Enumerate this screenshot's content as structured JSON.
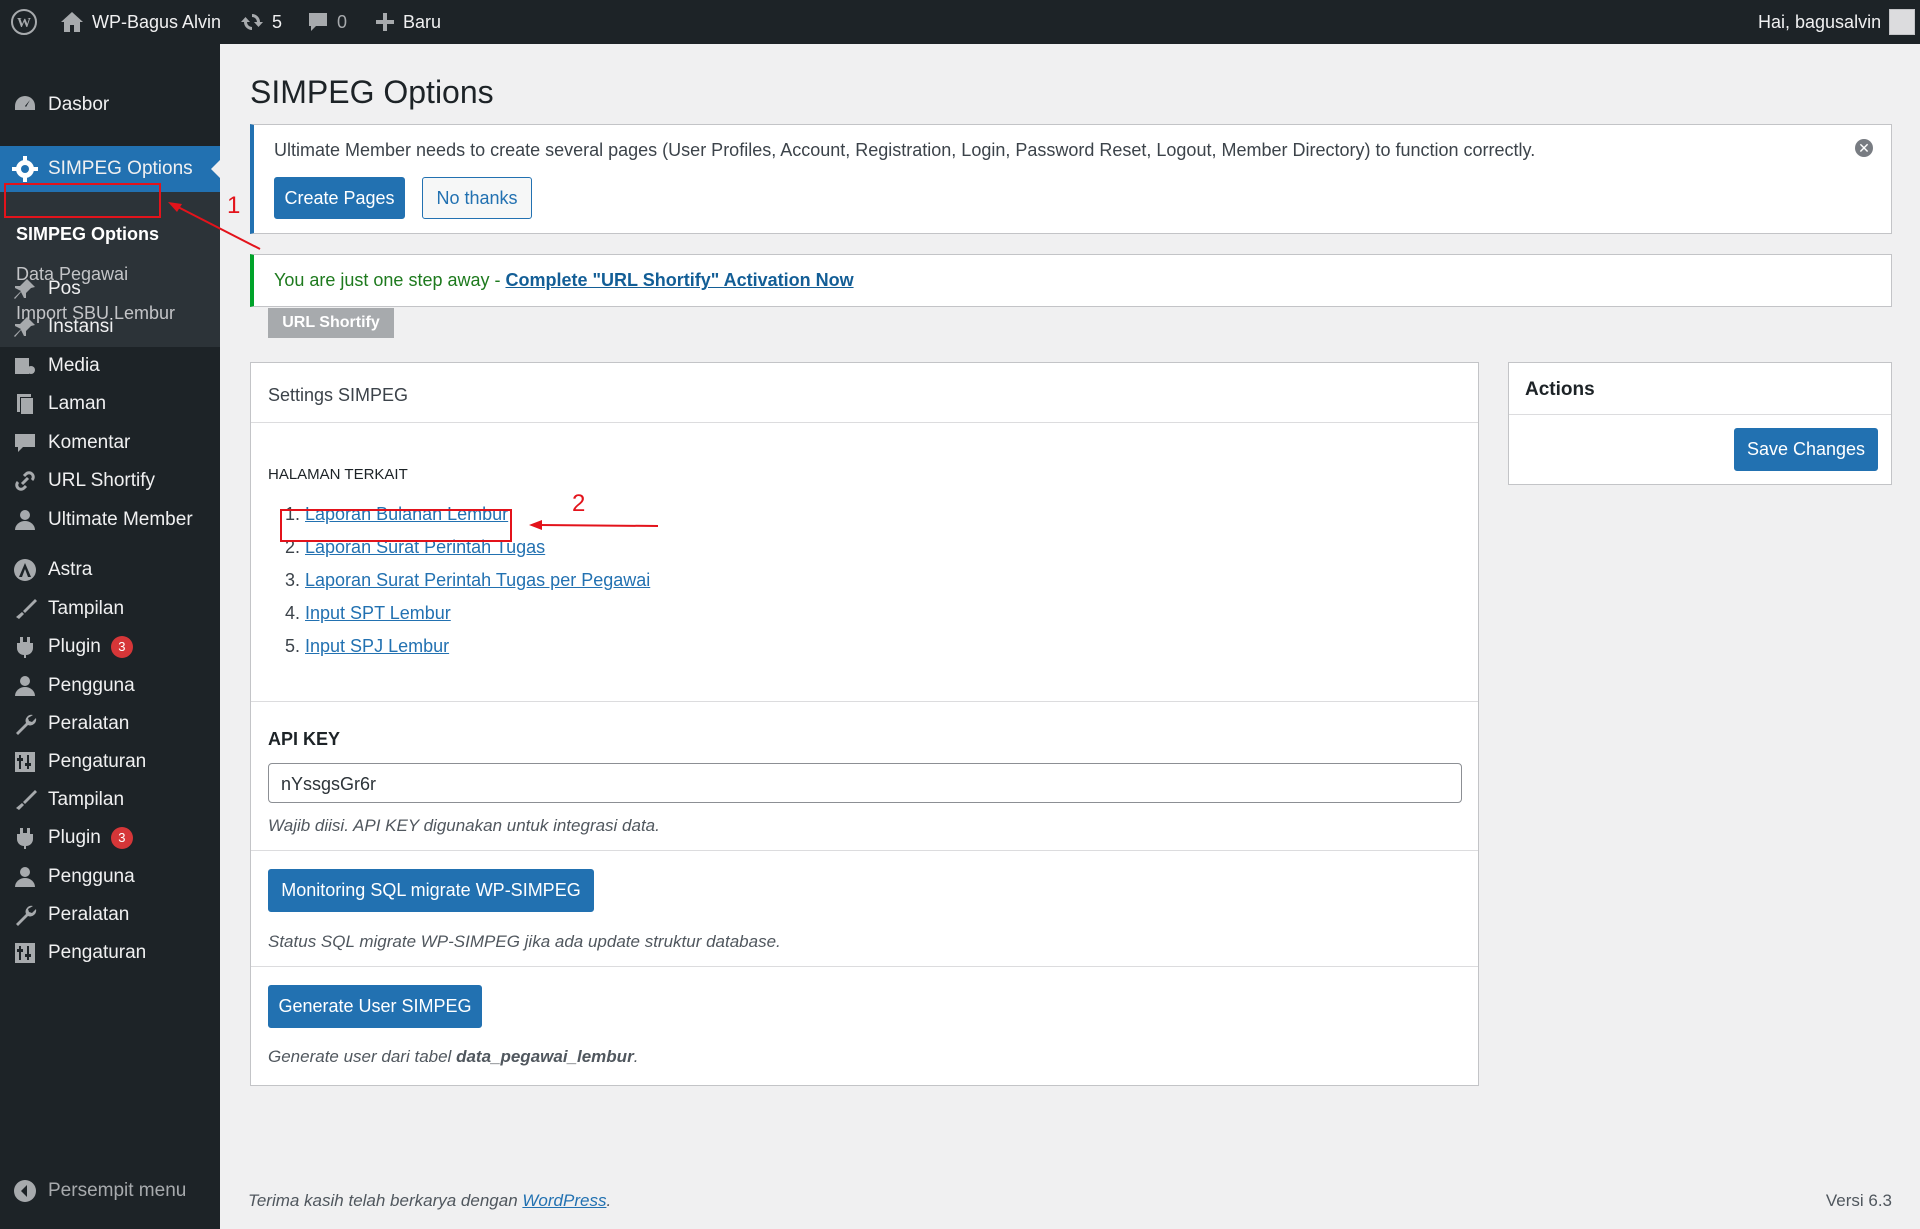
{
  "admin_bar": {
    "site_name": "WP-Bagus Alvin",
    "updates_count": "5",
    "comments_count": "0",
    "new_label": "Baru",
    "greeting": "Hai, bagusalvin"
  },
  "sidebar": {
    "dashboard": "Dasbor",
    "active_menu": "SIMPEG Options",
    "submenu": [
      "SIMPEG Options",
      "Data Pegawai",
      "Import SBU Lembur"
    ],
    "items": [
      {
        "label": "Pos",
        "icon": "pin-icon"
      },
      {
        "label": "Instansi",
        "icon": "pin-icon"
      },
      {
        "label": "Media",
        "icon": "media-icon"
      },
      {
        "label": "Laman",
        "icon": "page-icon"
      },
      {
        "label": "Komentar",
        "icon": "comment-icon"
      },
      {
        "label": "URL Shortify",
        "icon": "link-icon"
      },
      {
        "label": "Ultimate Member",
        "icon": "user-icon"
      },
      {
        "label": "Astra",
        "icon": "astra-icon"
      },
      {
        "label": "Tampilan",
        "icon": "brush-icon"
      },
      {
        "label": "Plugin",
        "icon": "plugin-icon",
        "badge": "3"
      },
      {
        "label": "Pengguna",
        "icon": "user-icon"
      },
      {
        "label": "Peralatan",
        "icon": "wrench-icon"
      },
      {
        "label": "Pengaturan",
        "icon": "settings-icon"
      },
      {
        "label": "Tampilan",
        "icon": "brush-icon"
      },
      {
        "label": "Plugin",
        "icon": "plugin-icon",
        "badge": "3"
      },
      {
        "label": "Pengguna",
        "icon": "user-icon"
      },
      {
        "label": "Peralatan",
        "icon": "wrench-icon"
      },
      {
        "label": "Pengaturan",
        "icon": "settings-icon"
      }
    ],
    "collapse": "Persempit menu"
  },
  "page": {
    "title": "SIMPEG Options"
  },
  "um_notice": {
    "text": "Ultimate Member needs to create several pages (User Profiles, Account, Registration, Login, Password Reset, Logout, Member Directory) to function correctly.",
    "create_label": "Create Pages",
    "no_thanks_label": "No thanks"
  },
  "shortify_notice": {
    "text": "You are just one step away - ",
    "link": "Complete \"URL Shortify\" Activation Now",
    "tag": "URL Shortify"
  },
  "settings": {
    "title": "Settings SIMPEG",
    "related_heading": "HALAMAN TERKAIT",
    "related_pages": [
      {
        "num": "1.",
        "label": "Laporan Bulanan Lembur"
      },
      {
        "num": "2.",
        "label": "Laporan Surat Perintah Tugas"
      },
      {
        "num": "3.",
        "label": "Laporan Surat Perintah Tugas per Pegawai"
      },
      {
        "num": "4.",
        "label": "Input SPT Lembur"
      },
      {
        "num": "5.",
        "label": "Input SPJ Lembur"
      }
    ],
    "api_key_label": "API KEY",
    "api_key_value": "nYssgsGr6r",
    "api_key_help": "Wajib diisi. API KEY digunakan untuk integrasi data.",
    "monitor_button": "Monitoring SQL migrate WP-SIMPEG",
    "monitor_help": "Status SQL migrate WP-SIMPEG jika ada update struktur database.",
    "generate_button": "Generate User SIMPEG",
    "generate_help_prefix": "Generate user dari tabel ",
    "generate_help_table": "data_pegawai_lembur",
    "generate_help_suffix": "."
  },
  "actions": {
    "title": "Actions",
    "save_label": "Save Changes"
  },
  "footer": {
    "thanks_prefix": "Terima kasih telah berkarya dengan ",
    "wp_link": "WordPress",
    "thanks_suffix": ".",
    "version": "Versi 6.3"
  },
  "annotations": {
    "one": "1",
    "two": "2"
  },
  "colors": {
    "accent": "#2271b1",
    "adminbar": "#1d2327",
    "annotation": "#e3131b",
    "badge": "#d63638",
    "success_border": "#00a32a"
  }
}
